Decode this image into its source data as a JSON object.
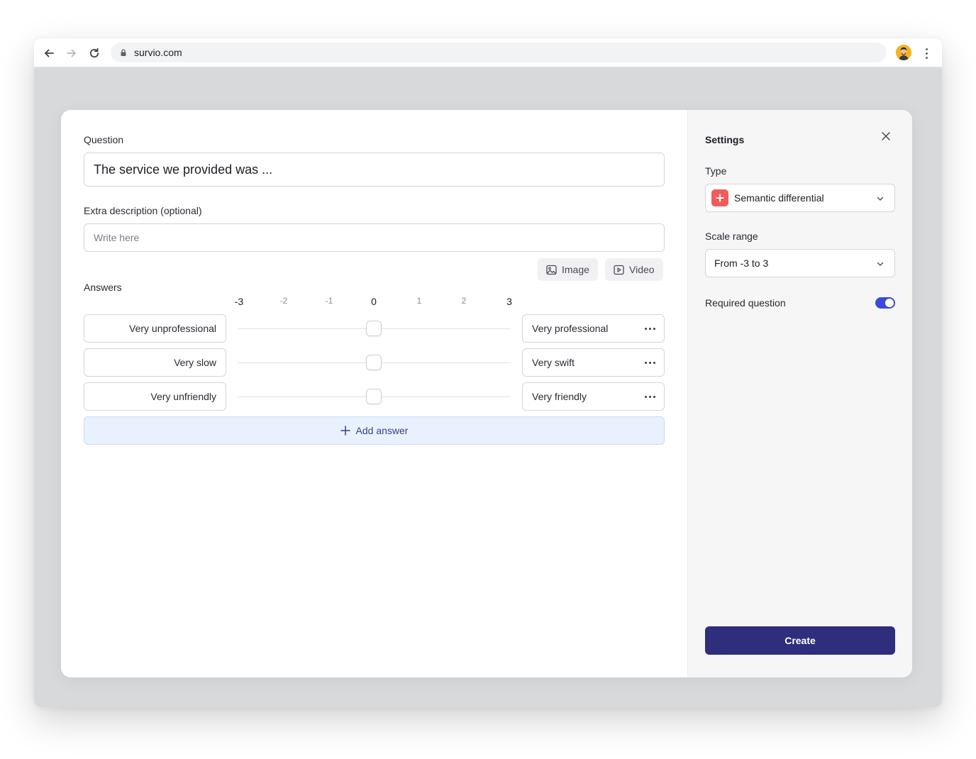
{
  "browser": {
    "url": "survio.com"
  },
  "editor": {
    "question_label": "Question",
    "question_value": "The service we provided was ...",
    "description_label": "Extra description (optional)",
    "description_placeholder": "Write here",
    "image_button": "Image",
    "video_button": "Video",
    "answers_label": "Answers",
    "scale": [
      "-3",
      "-2",
      "-1",
      "0",
      "1",
      "2",
      "3"
    ],
    "answers": [
      {
        "left": "Very unprofessional",
        "right": "Very professional",
        "value": 0
      },
      {
        "left": "Very slow",
        "right": "Very swift",
        "value": 0
      },
      {
        "left": "Very unfriendly",
        "right": "Very friendly",
        "value": 0
      }
    ],
    "add_answer": "Add answer"
  },
  "settings": {
    "title": "Settings",
    "type_label": "Type",
    "type_value": "Semantic differential",
    "scale_label": "Scale range",
    "scale_value": "From -3 to 3",
    "required_label": "Required question",
    "required_on": true,
    "create_button": "Create"
  },
  "colors": {
    "accent": "#2e2e7d",
    "toggle": "#3b4bd8",
    "type_icon": "#f25b5b",
    "add_answer_bg": "#e8f1fd"
  }
}
